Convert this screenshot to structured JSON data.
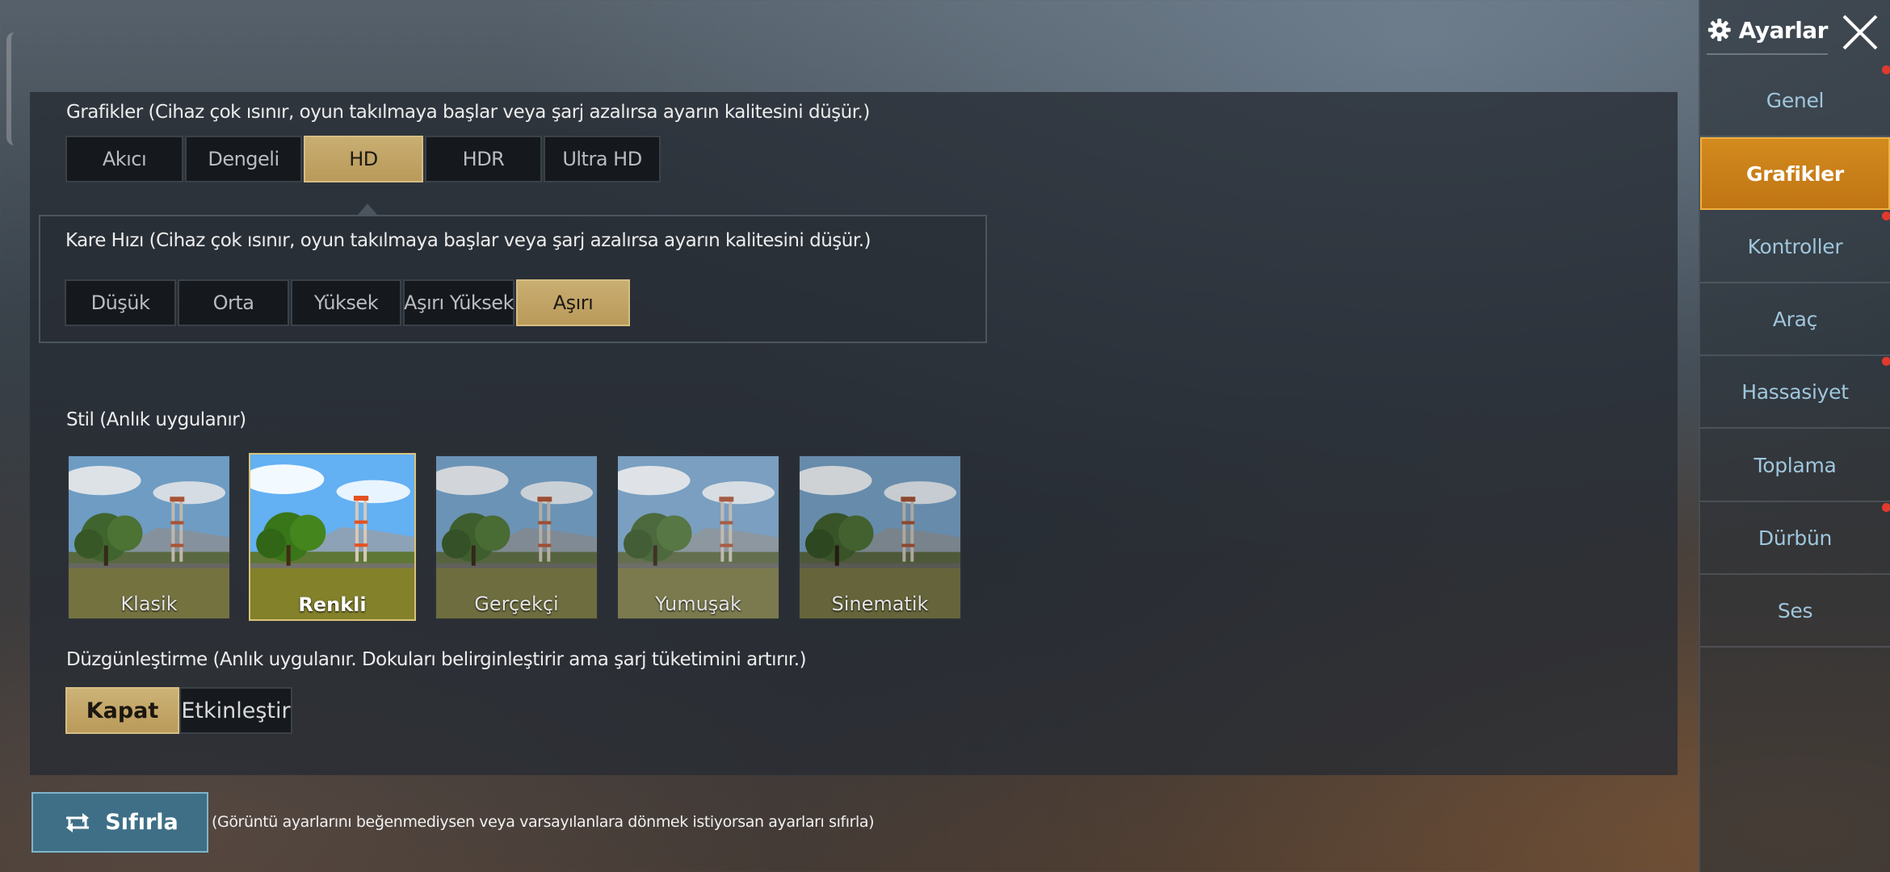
{
  "sidebar": {
    "title": "Ayarlar",
    "items": [
      {
        "label": "Genel"
      },
      {
        "label": "Grafikler"
      },
      {
        "label": "Kontroller"
      },
      {
        "label": "Araç"
      },
      {
        "label": "Hassasiyet"
      },
      {
        "label": "Toplama"
      },
      {
        "label": "Dürbün"
      },
      {
        "label": "Ses"
      }
    ],
    "active_item": "Grafikler",
    "accent_color": "#d38a1e"
  },
  "graphics": {
    "label": "Grafikler (Cihaz çok ısınır, oyun takılmaya başlar veya şarj azalırsa ayarın kalitesini düşür.)",
    "options": [
      "Akıcı",
      "Dengeli",
      "HD",
      "HDR",
      "Ultra HD"
    ],
    "selected": "HD"
  },
  "frame_rate": {
    "label": "Kare Hızı (Cihaz çok ısınır, oyun takılmaya başlar veya şarj azalırsa ayarın kalitesini düşür.)",
    "options": [
      "Düşük",
      "Orta",
      "Yüksek",
      "Aşırı Yüksek",
      "Aşırı"
    ],
    "selected": "Aşırı"
  },
  "style": {
    "label": "Stil (Anlık uygulanır)",
    "options": [
      "Klasik",
      "Renkli",
      "Gerçekçi",
      "Yumuşak",
      "Sinematik"
    ],
    "selected": "Renkli"
  },
  "smoothing": {
    "label": "Düzgünleştirme (Anlık uygulanır. Dokuları belirginleştirir ama şarj tüketimini artırır.)",
    "options": [
      "Kapat",
      "Etkinleştir"
    ],
    "selected": "Kapat"
  },
  "reset": {
    "label": "Sıfırla",
    "note": "(Görüntü ayarlarını beğenmediysen veya varsayılanlara dönmek istiyorsan ayarları sıfırla)"
  },
  "colors": {
    "selected_gold": "#c9ae72",
    "reset_blue": "#3e6f87",
    "notification_red": "#e03a2c"
  }
}
